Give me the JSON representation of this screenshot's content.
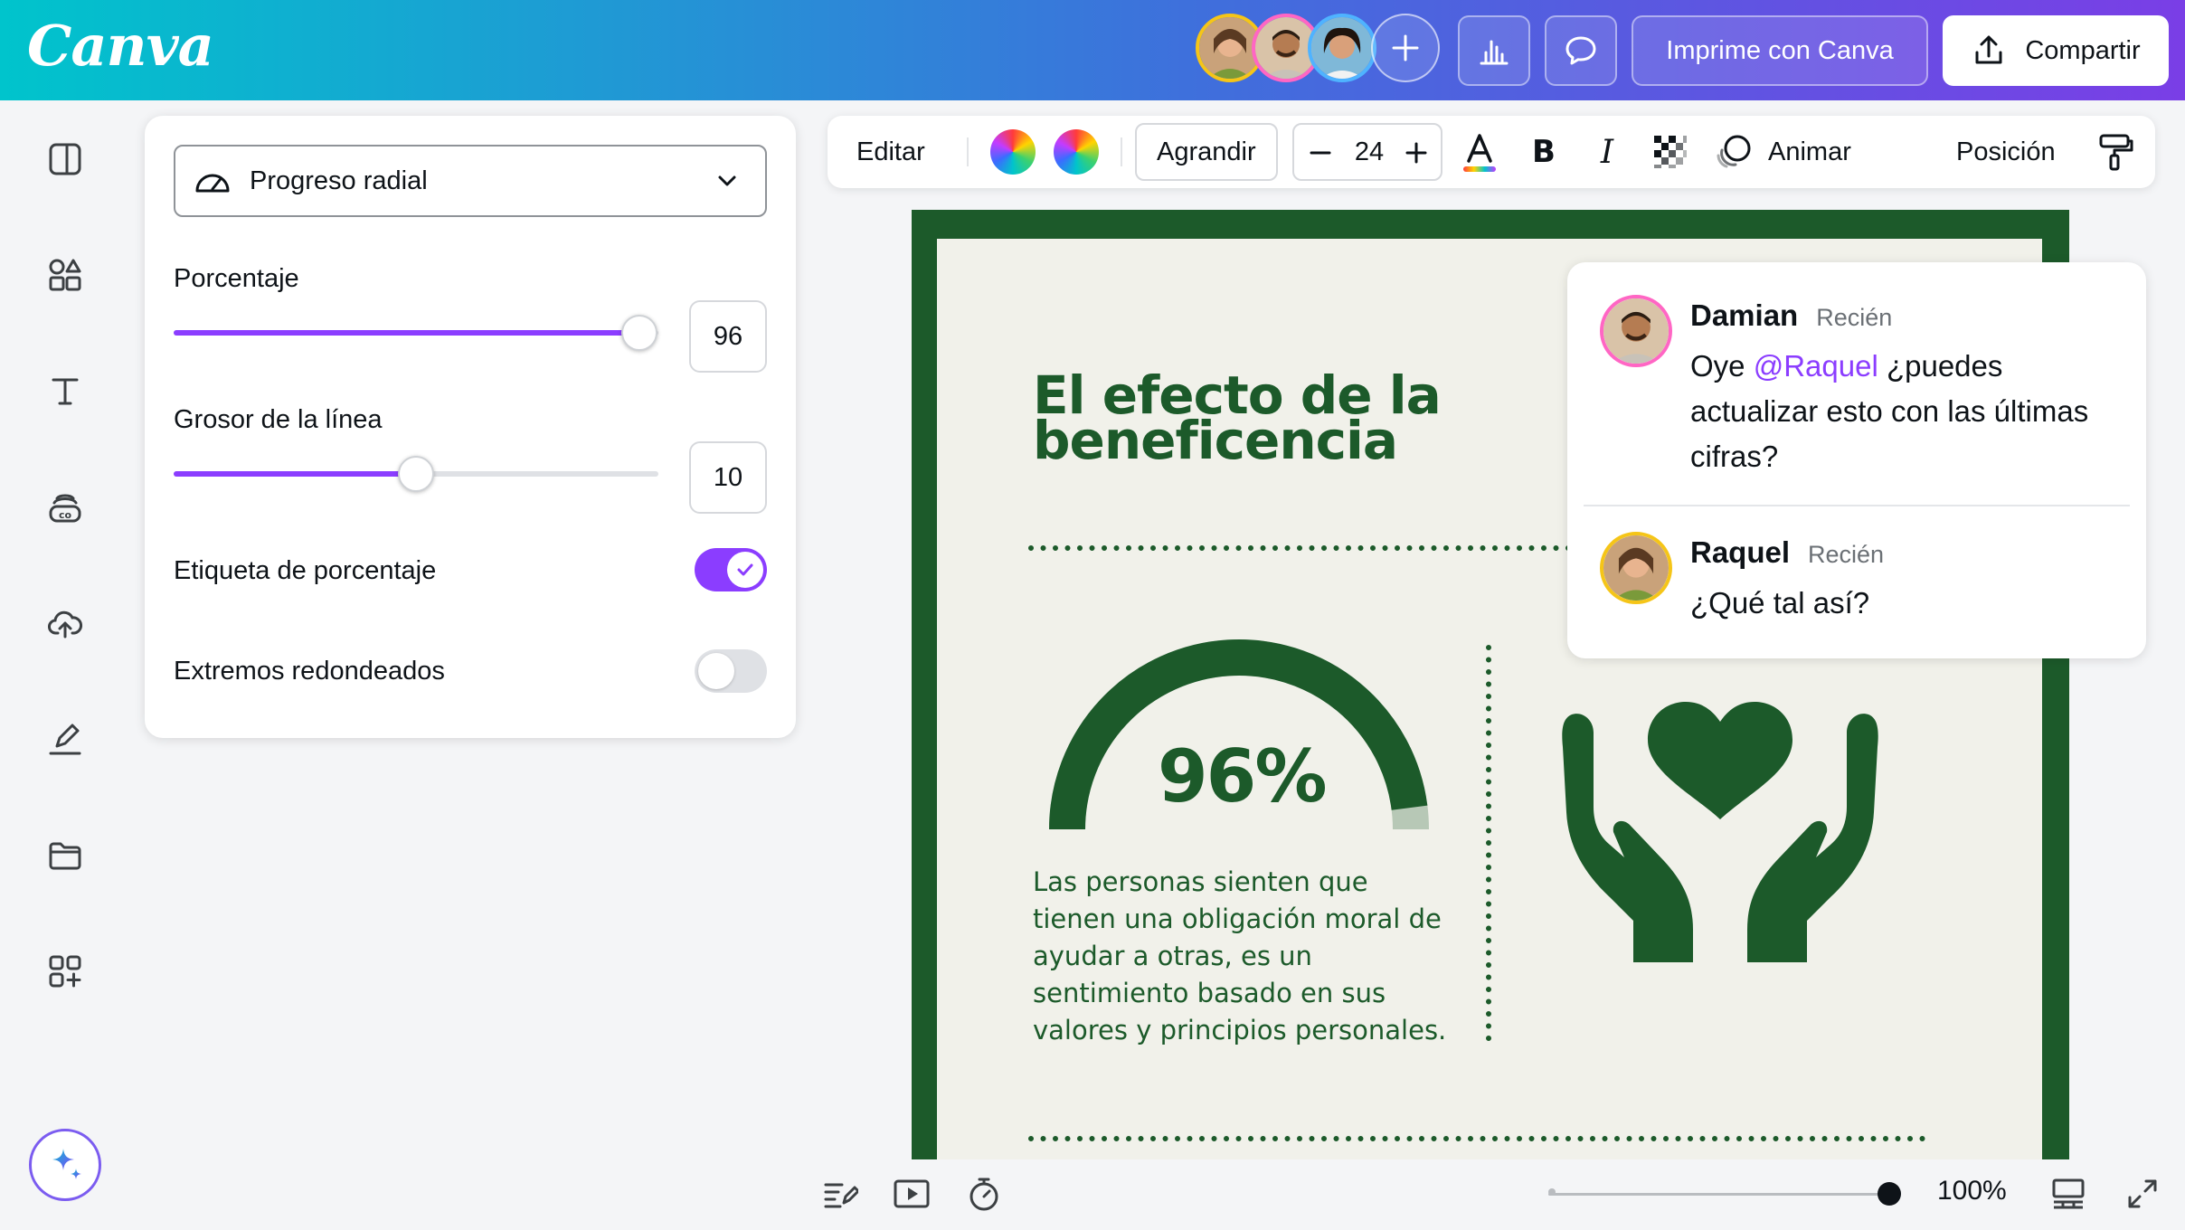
{
  "header": {
    "logo": "Canva",
    "print_label": "Imprime con Canva",
    "share_label": "Compartir"
  },
  "panel": {
    "dropdown_label": "Progreso radial",
    "percentage_label": "Porcentaje",
    "percentage_value": "96",
    "percentage_fraction": 0.96,
    "thickness_label": "Grosor de la línea",
    "thickness_value": "10",
    "thickness_fraction": 0.5,
    "percent_label_toggle": "Etiqueta de porcentaje",
    "percent_label_on": true,
    "rounded_ends_toggle": "Extremos redondeados",
    "rounded_ends_on": false
  },
  "toolbar": {
    "edit": "Editar",
    "grow": "Agrandir",
    "font_size": "24",
    "animate": "Animar",
    "position": "Posición"
  },
  "design": {
    "title_line1": "El efecto de la",
    "title_line2": "beneficencia",
    "percent": "96%",
    "body": "Las personas sienten que tienen una obligación moral de ayudar a otras, es un sentimiento basado en sus valores y principios personales.",
    "color_bg": "#f1f1ea",
    "color_primary": "#1c5a2a"
  },
  "comments": [
    {
      "name": "Damian",
      "time": "Recién",
      "text_pre": "Oye ",
      "mention": "@Raquel",
      "text_post": " ¿puedes actualizar esto con las últimas cifras?"
    },
    {
      "name": "Raquel",
      "time": "Recién",
      "text": "¿Qué tal así?"
    }
  ],
  "footer": {
    "zoom": "100%"
  },
  "colors": {
    "accent": "#8b3dff",
    "brand_gradient_start": "#00c4cc",
    "brand_gradient_end": "#7a3ee6"
  }
}
